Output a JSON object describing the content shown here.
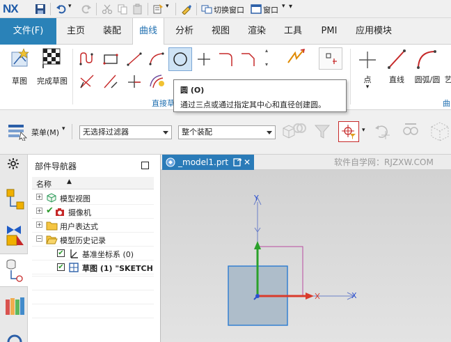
{
  "app": {
    "logo": "NX"
  },
  "quick_access": {
    "switch_window": "切换窗口",
    "window_menu": "窗口"
  },
  "menubar": {
    "file": "文件(F)",
    "tabs": [
      "主页",
      "装配",
      "曲线",
      "分析",
      "视图",
      "渲染",
      "工具",
      "PMI",
      "应用模块"
    ],
    "active_tab": "曲线"
  },
  "ribbon": {
    "sketch": "草图",
    "finish_sketch": "完成草图",
    "group_direct_sketch": "直接草",
    "point": "点",
    "line": "直线",
    "arc_circle": "圆弧/圆",
    "art": "艺",
    "group_curve": "曲"
  },
  "tooltip": {
    "title": "圆 (O)",
    "description": "通过三点或通过指定其中心和直径创建圆。"
  },
  "selbar": {
    "menu_label": "菜单(M)",
    "filter_value": "无选择过滤器",
    "scope_value": "整个装配"
  },
  "navigator": {
    "title": "部件导航器",
    "column": "名称",
    "items": [
      {
        "label": "模型视图"
      },
      {
        "label": "摄像机"
      },
      {
        "label": "用户表达式"
      },
      {
        "label": "模型历史记录"
      },
      {
        "label": "基准坐标系 (0)"
      },
      {
        "label": "草图 (1) \"SKETCH"
      }
    ]
  },
  "viewport": {
    "tab_label": "_model1.prt",
    "watermark": "软件自学网：RJZXW.COM",
    "axis_x": "X",
    "axis_y": "Y"
  },
  "colors": {
    "accent": "#2a82b8",
    "x_axis": "#d93a2b",
    "y_axis": "#2aa12a",
    "z_axis": "#2a4fd0"
  }
}
